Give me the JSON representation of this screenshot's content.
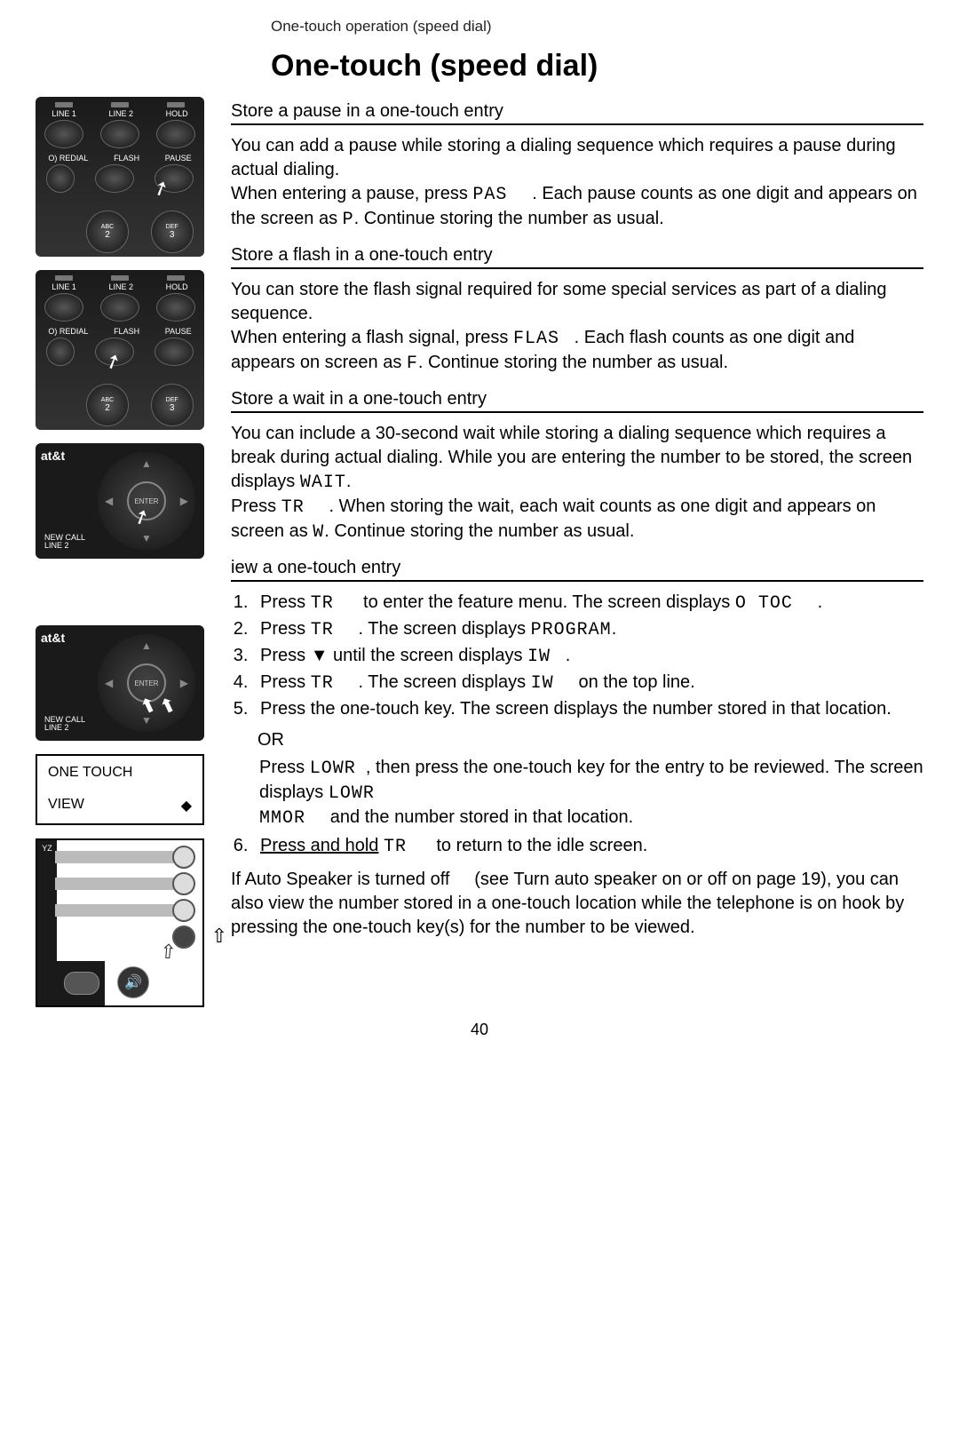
{
  "header": {
    "breadcrumb": "One-touch operation (speed dial)"
  },
  "title": "One-touch (speed dial)",
  "sections": {
    "pause": {
      "heading": "Store a pause in a one-touch entry",
      "p1a": "You can add a pause while storing a dialing sequence which requires a pause during actual dialing.",
      "p1b_pre": "When entering a pause, press ",
      "p1b_key": "PAS",
      "p1b_mid": ". Each pause counts as one digit and appears on the screen as ",
      "p1b_code": "P",
      "p1b_post": ". Continue storing the number as usual."
    },
    "flash": {
      "heading": "Store a flash in a one-touch entry",
      "p1a": "You can store the flash signal required for some special services as part of a dialing sequence.",
      "p1b_pre": "When entering a flash signal, press ",
      "p1b_key": "FLAS",
      "p1b_mid": ". Each flash counts as one digit and appears on screen as ",
      "p1b_code": "F",
      "p1b_post": ". Continue storing the number as usual."
    },
    "wait": {
      "heading": "Store a wait in a one-touch entry",
      "p1a": "You can include a 30-second wait while storing a dialing sequence which requires a break during actual dialing. While you are entering the number to be stored, the screen displays ",
      "p1a_code": "WAIT",
      "p1a_post": ".",
      "p1b_pre": "Press ",
      "p1b_key": "TR",
      "p1b_mid": ". When storing the wait, each wait counts as one digit and appears on screen as ",
      "p1b_code": "W",
      "p1b_post": ". Continue storing the number as usual."
    },
    "view": {
      "heading": "iew a one-touch entry",
      "steps": {
        "s1_pre": "Press ",
        "s1_key": "TR",
        "s1_mid": " to enter the feature menu. The screen displays ",
        "s1_code": "O TOC",
        "s1_post": ".",
        "s2_pre": "Press ",
        "s2_key": "TR",
        "s2_mid": ". The screen displays ",
        "s2_code": "PROGRAM",
        "s2_post": ".",
        "s3_pre": "Press ",
        "s3_sym": "▼",
        "s3_mid": " until the screen displays ",
        "s3_code": "IW",
        "s3_post": ".",
        "s4_pre": "Press ",
        "s4_key": "TR",
        "s4_mid": ". The screen displays ",
        "s4_code": "IW",
        "s4_post": " on the top line.",
        "s5": "Press the one-touch key. The screen displays the number stored in that location.",
        "or": "OR",
        "alt_pre": "Press ",
        "alt_key1": "LOWR",
        "alt_mid1": ", then press the one-touch key for the entry to be reviewed. The screen displays ",
        "alt_code1": "LOWR",
        "alt_code2": "MMOR",
        "alt_mid2": " and the number stored in that location.",
        "s6_pre": "Press and hold",
        "s6_key": "TR",
        "s6_post": " to return to the idle screen."
      },
      "note_pre": "If Auto Speaker is turned off",
      "note_mid": " (see ",
      "note_link": "Turn auto speaker on or off",
      "note_post": " on page 19), you can also view the number stored in a one-touch location while the telephone is on hook by pressing the one-touch key(s) for the number to be viewed."
    }
  },
  "lcd": {
    "line1": "ONE TOUCH",
    "line2": "VIEW",
    "arrows": "◆"
  },
  "phone_labels": {
    "line1": "LINE 1",
    "line2": "LINE 2",
    "hold": "HOLD",
    "redial": "O) REDIAL",
    "flash": "FLASH",
    "pause": "PAUSE",
    "abc": "ABC",
    "def": "DEF",
    "two": "2",
    "three": "3",
    "att": "at&t",
    "enter": "ENTER",
    "newcall": "NEW CALL",
    "line2b": "LINE 2",
    "yz": "YZ"
  },
  "page_number": "40"
}
